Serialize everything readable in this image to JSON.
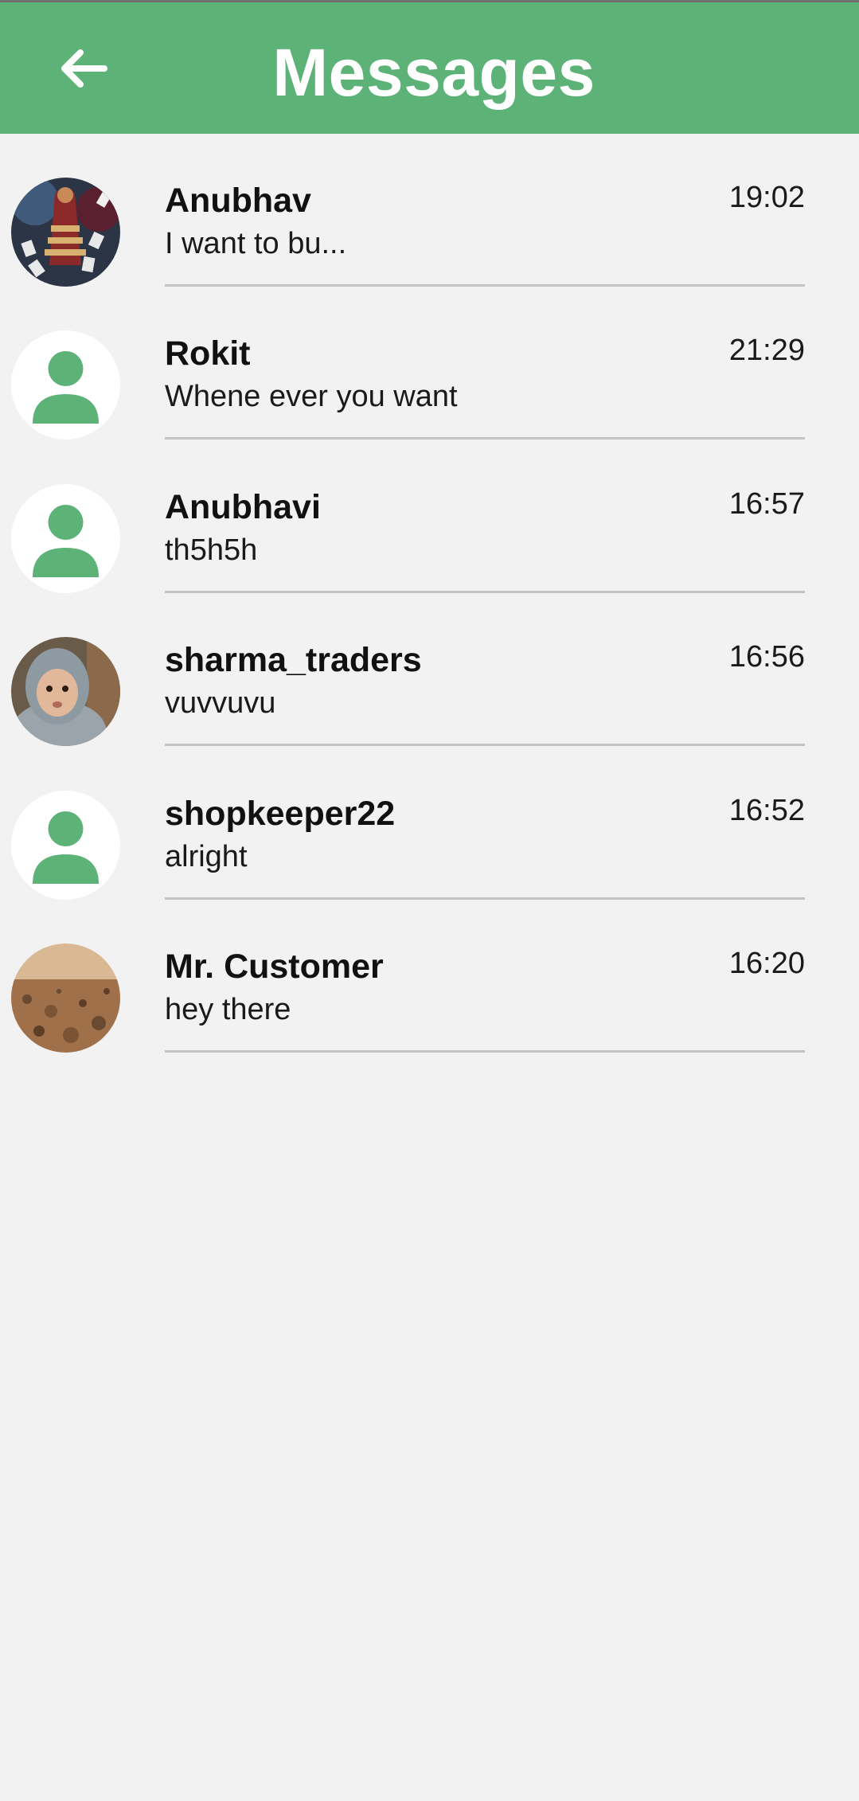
{
  "header": {
    "title": "Messages",
    "back_icon": "arrow-left-icon",
    "background_color": "#5db377"
  },
  "conversations": [
    {
      "name": "Anubhav",
      "preview": "I want to bu...",
      "time": "19:02",
      "avatar": "photo-avatar"
    },
    {
      "name": "Rokit",
      "preview": "Whene ever you want",
      "time": "21:29",
      "avatar": "default-user-icon"
    },
    {
      "name": "Anubhavi",
      "preview": "th5h5h",
      "time": "16:57",
      "avatar": "default-user-icon"
    },
    {
      "name": "sharma_traders",
      "preview": "vuvvuvu",
      "time": "16:56",
      "avatar": "photo-avatar"
    },
    {
      "name": "shopkeeper22",
      "preview": "alright",
      "time": "16:52",
      "avatar": "default-user-icon"
    },
    {
      "name": "Mr. Customer",
      "preview": "hey there",
      "time": "16:20",
      "avatar": "photo-avatar"
    }
  ]
}
